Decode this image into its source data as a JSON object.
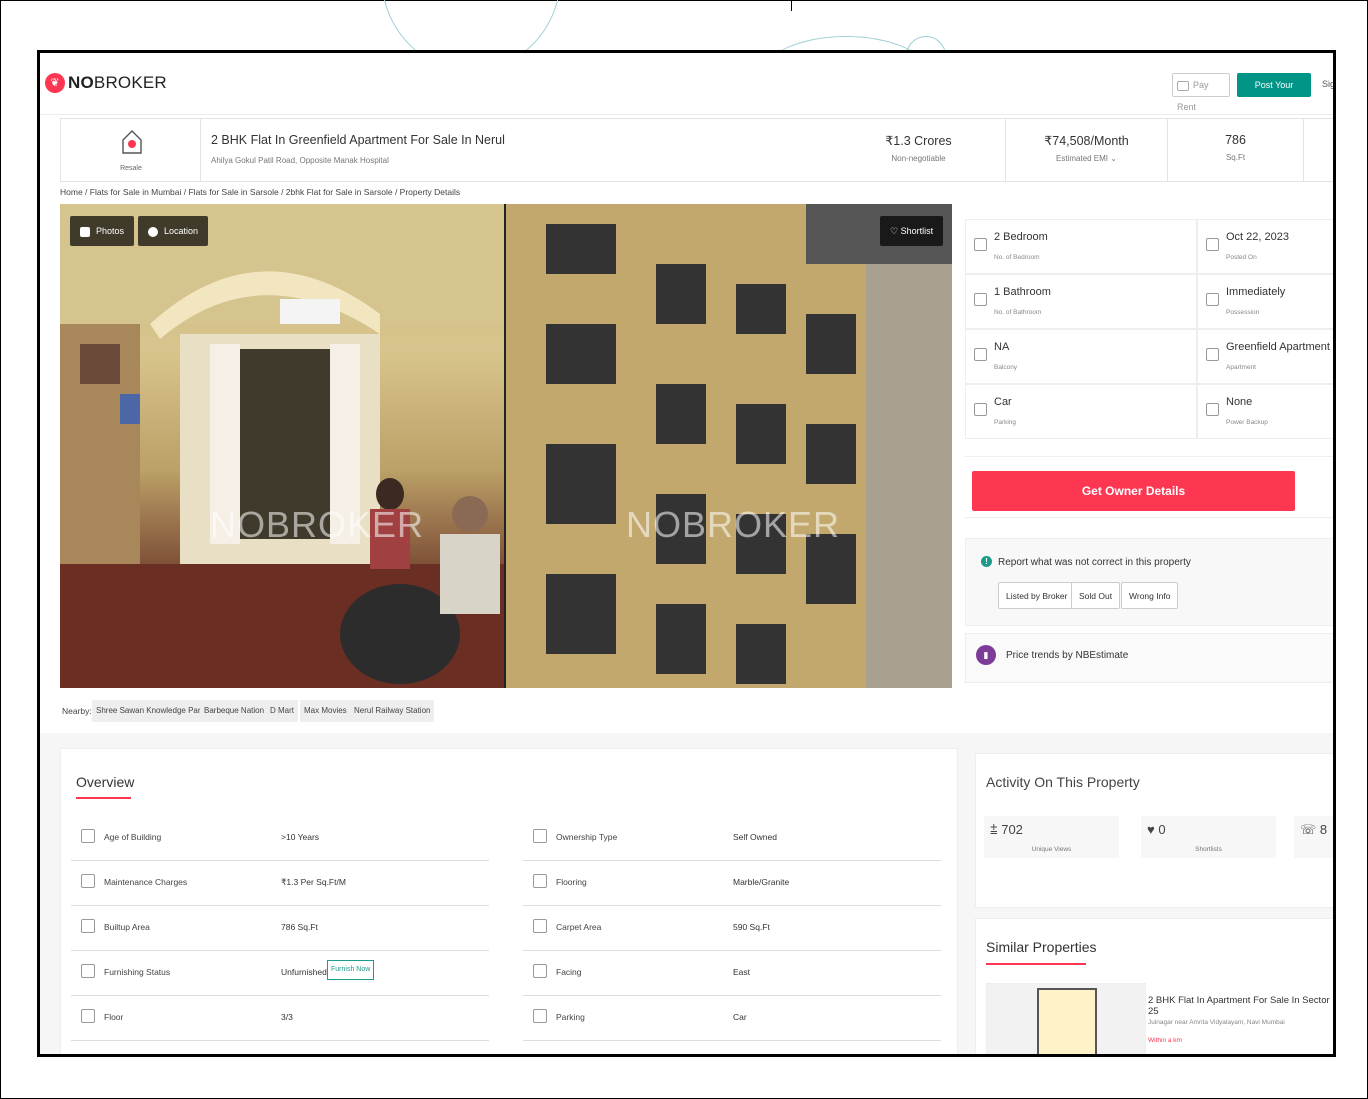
{
  "header": {
    "logo_text_bold": "NO",
    "logo_text_rest": "BROKER",
    "pay_rent": "Pay Rent",
    "post_property": "Post Your Property",
    "sign_in": "Sig"
  },
  "summary": {
    "badge": "Resale",
    "title": "2 BHK Flat In Greenfield Apartment For Sale In Nerul",
    "address": "Ahilya Gokul Patil Road, Opposite Manak Hospital",
    "price": "₹1.3 Crores",
    "price_note": "Non-negotiable",
    "emi": "₹74,508/Month",
    "emi_note": "Estimated EMI ⌄",
    "area": "786",
    "area_unit": "Sq.Ft"
  },
  "breadcrumb": "Home / Flats for Sale in Mumbai / Flats for Sale in Sarsole / 2bhk Flat for Sale in Sarsole / Property Details",
  "gallery": {
    "photos": "Photos",
    "location": "Location",
    "shortlist": "Shortlist",
    "watermark": "NOBROKER"
  },
  "details": [
    {
      "value": "2 Bedroom",
      "label": "No. of Bedroom",
      "icon": "bed-icon"
    },
    {
      "value": "Oct 22, 2023",
      "label": "Posted On",
      "icon": "calendar-icon"
    },
    {
      "value": "1 Bathroom",
      "label": "No. of Bathroom",
      "icon": "bath-icon"
    },
    {
      "value": "Immediately",
      "label": "Possession",
      "icon": "key-icon"
    },
    {
      "value": "NA",
      "label": "Balcony",
      "icon": "balcony-icon"
    },
    {
      "value": "Greenfield Apartment",
      "label": "Apartment",
      "icon": "building-icon"
    },
    {
      "value": "Car",
      "label": "Parking",
      "icon": "car-icon"
    },
    {
      "value": "None",
      "label": "Power Backup",
      "icon": "battery-icon"
    }
  ],
  "owner_button": "Get Owner Details",
  "report": {
    "title": "Report what was not correct in this property",
    "buttons": [
      "Listed by Broker",
      "Sold Out",
      "Wrong Info"
    ]
  },
  "price_trends": "Price trends by NBEstimate",
  "nearby": {
    "label": "Nearby:",
    "items": [
      "Shree Sawan Knowledge Park",
      "Barbeque Nation",
      "D Mart",
      "Max Movies",
      "Nerul Railway Station"
    ]
  },
  "overview": {
    "title": "Overview",
    "left": [
      {
        "label": "Age of Building",
        "value": ">10 Years"
      },
      {
        "label": "Maintenance Charges",
        "value": "₹1.3 Per Sq.Ft/M"
      },
      {
        "label": "Builtup Area",
        "value": "786 Sq.Ft"
      },
      {
        "label": "Furnishing Status",
        "value": "Unfurnished"
      },
      {
        "label": "Floor",
        "value": "3/3"
      }
    ],
    "right": [
      {
        "label": "Ownership Type",
        "value": "Self Owned"
      },
      {
        "label": "Flooring",
        "value": "Marble/Granite"
      },
      {
        "label": "Carpet Area",
        "value": "590 Sq.Ft"
      },
      {
        "label": "Facing",
        "value": "East"
      },
      {
        "label": "Parking",
        "value": "Car"
      }
    ],
    "furnish_now": "Furnish Now"
  },
  "activity": {
    "title": "Activity On This Property",
    "views": "702",
    "views_label": "Unique Views",
    "shortlists": "0",
    "shortlists_label": "Shortlists",
    "calls": "8"
  },
  "similar": {
    "title": "Similar Properties",
    "name": "2 BHK Flat In Apartment For Sale In Sector 25",
    "address": "Juinagar near Amrita Vidyalayam, Navi Mumbai",
    "distance": "Within a km"
  },
  "colors": {
    "brand": "#fd3752",
    "teal": "#009587"
  }
}
